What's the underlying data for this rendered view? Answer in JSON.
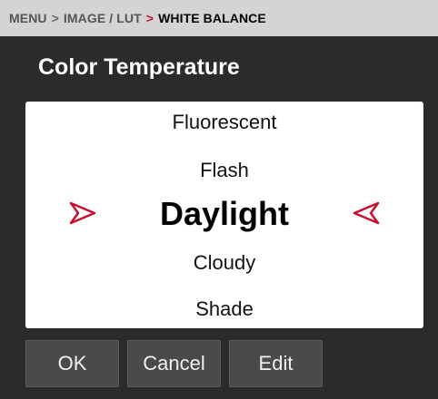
{
  "breadcrumb": {
    "menu": "MENU",
    "image_lut": "IMAGE / LUT",
    "current": "WHITE BALANCE",
    "separator": ">"
  },
  "title": "Color Temperature",
  "picker": {
    "options": [
      "Fluorescent",
      "Flash",
      "Daylight",
      "Cloudy",
      "Shade"
    ],
    "selected": "Daylight"
  },
  "buttons": {
    "ok": "OK",
    "cancel": "Cancel",
    "edit": "Edit"
  },
  "colors": {
    "accent": "#c8102e",
    "background": "#2b2b2b",
    "breadcrumb_bg": "#d4d4d4"
  },
  "icons": {
    "left_arrow": "triangle-arrow-right-icon",
    "right_arrow": "triangle-arrow-left-icon"
  }
}
